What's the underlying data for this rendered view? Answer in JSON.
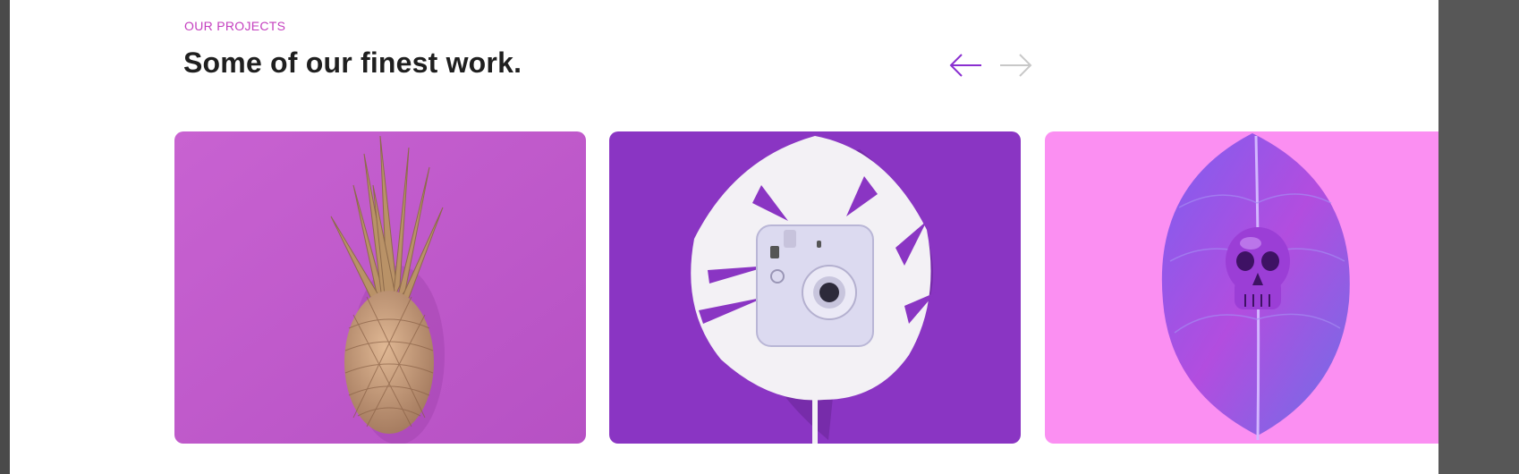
{
  "section": {
    "eyebrow": "OUR PROJECTS",
    "title": "Some of our finest work."
  },
  "carousel": {
    "prev_icon": "arrow-left-icon",
    "next_icon": "arrow-right-icon",
    "prev_color": "#8a2fd0",
    "next_color": "#c8c8c8",
    "projects": [
      {
        "image": "gold-pineapple-on-magenta",
        "background": "#c25ccc"
      },
      {
        "image": "instant-camera-on-white-leaf",
        "background": "#8a35c3"
      },
      {
        "image": "skull-on-purple-leaf",
        "background": "#fb8ff2"
      }
    ]
  },
  "colors": {
    "accent": "#c43fbf",
    "heading": "#1f1f1f"
  }
}
